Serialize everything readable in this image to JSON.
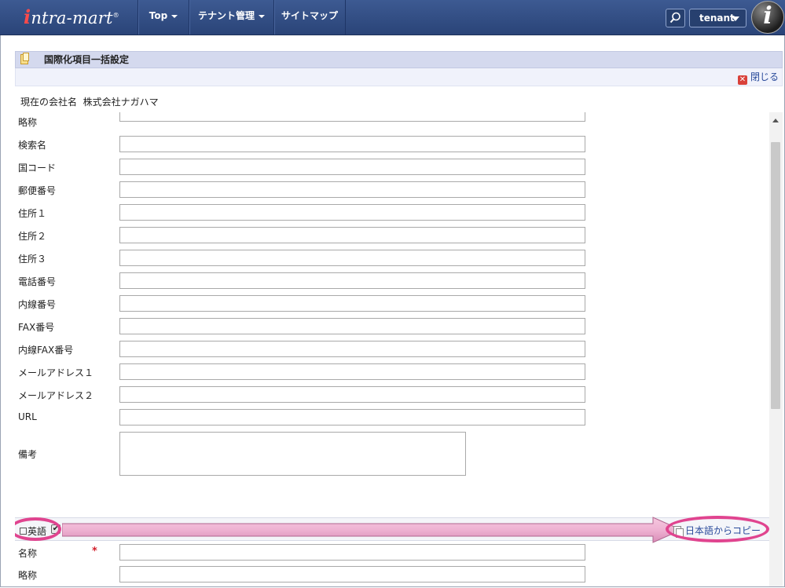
{
  "header": {
    "logo_prefix": "i",
    "logo_text": "ntra-mart",
    "logo_mark": "®",
    "nav": [
      {
        "label": "Top"
      },
      {
        "label": "テナント管理"
      },
      {
        "label": "サイトマップ"
      }
    ],
    "search_icon": "search-icon",
    "user_menu": "tenant",
    "info_badge": "i"
  },
  "page": {
    "title": "国際化項目一括設定",
    "close_label": "閉じる",
    "company_label": "現在の会社名",
    "company_name": "株式会社ナガハマ"
  },
  "form_fields": [
    {
      "label": "略称",
      "value": ""
    },
    {
      "label": "検索名",
      "value": ""
    },
    {
      "label": "国コード",
      "value": ""
    },
    {
      "label": "郵便番号",
      "value": ""
    },
    {
      "label": "住所１",
      "value": ""
    },
    {
      "label": "住所２",
      "value": ""
    },
    {
      "label": "住所３",
      "value": ""
    },
    {
      "label": "電話番号",
      "value": ""
    },
    {
      "label": "内線番号",
      "value": ""
    },
    {
      "label": "FAX番号",
      "value": ""
    },
    {
      "label": "内線FAX番号",
      "value": ""
    },
    {
      "label": "メールアドレス１",
      "value": ""
    },
    {
      "label": "メールアドレス２",
      "value": ""
    },
    {
      "label": "URL",
      "value": ""
    }
  ],
  "remarks": {
    "label": "備考",
    "value": ""
  },
  "english_section": {
    "label": "英語",
    "checked": true,
    "copy_label": "日本語からコピー",
    "highlight_color": "#e0448f",
    "fields": [
      {
        "label": "名称",
        "required_mark": "*",
        "value": ""
      },
      {
        "label": "略称",
        "value": ""
      }
    ]
  }
}
